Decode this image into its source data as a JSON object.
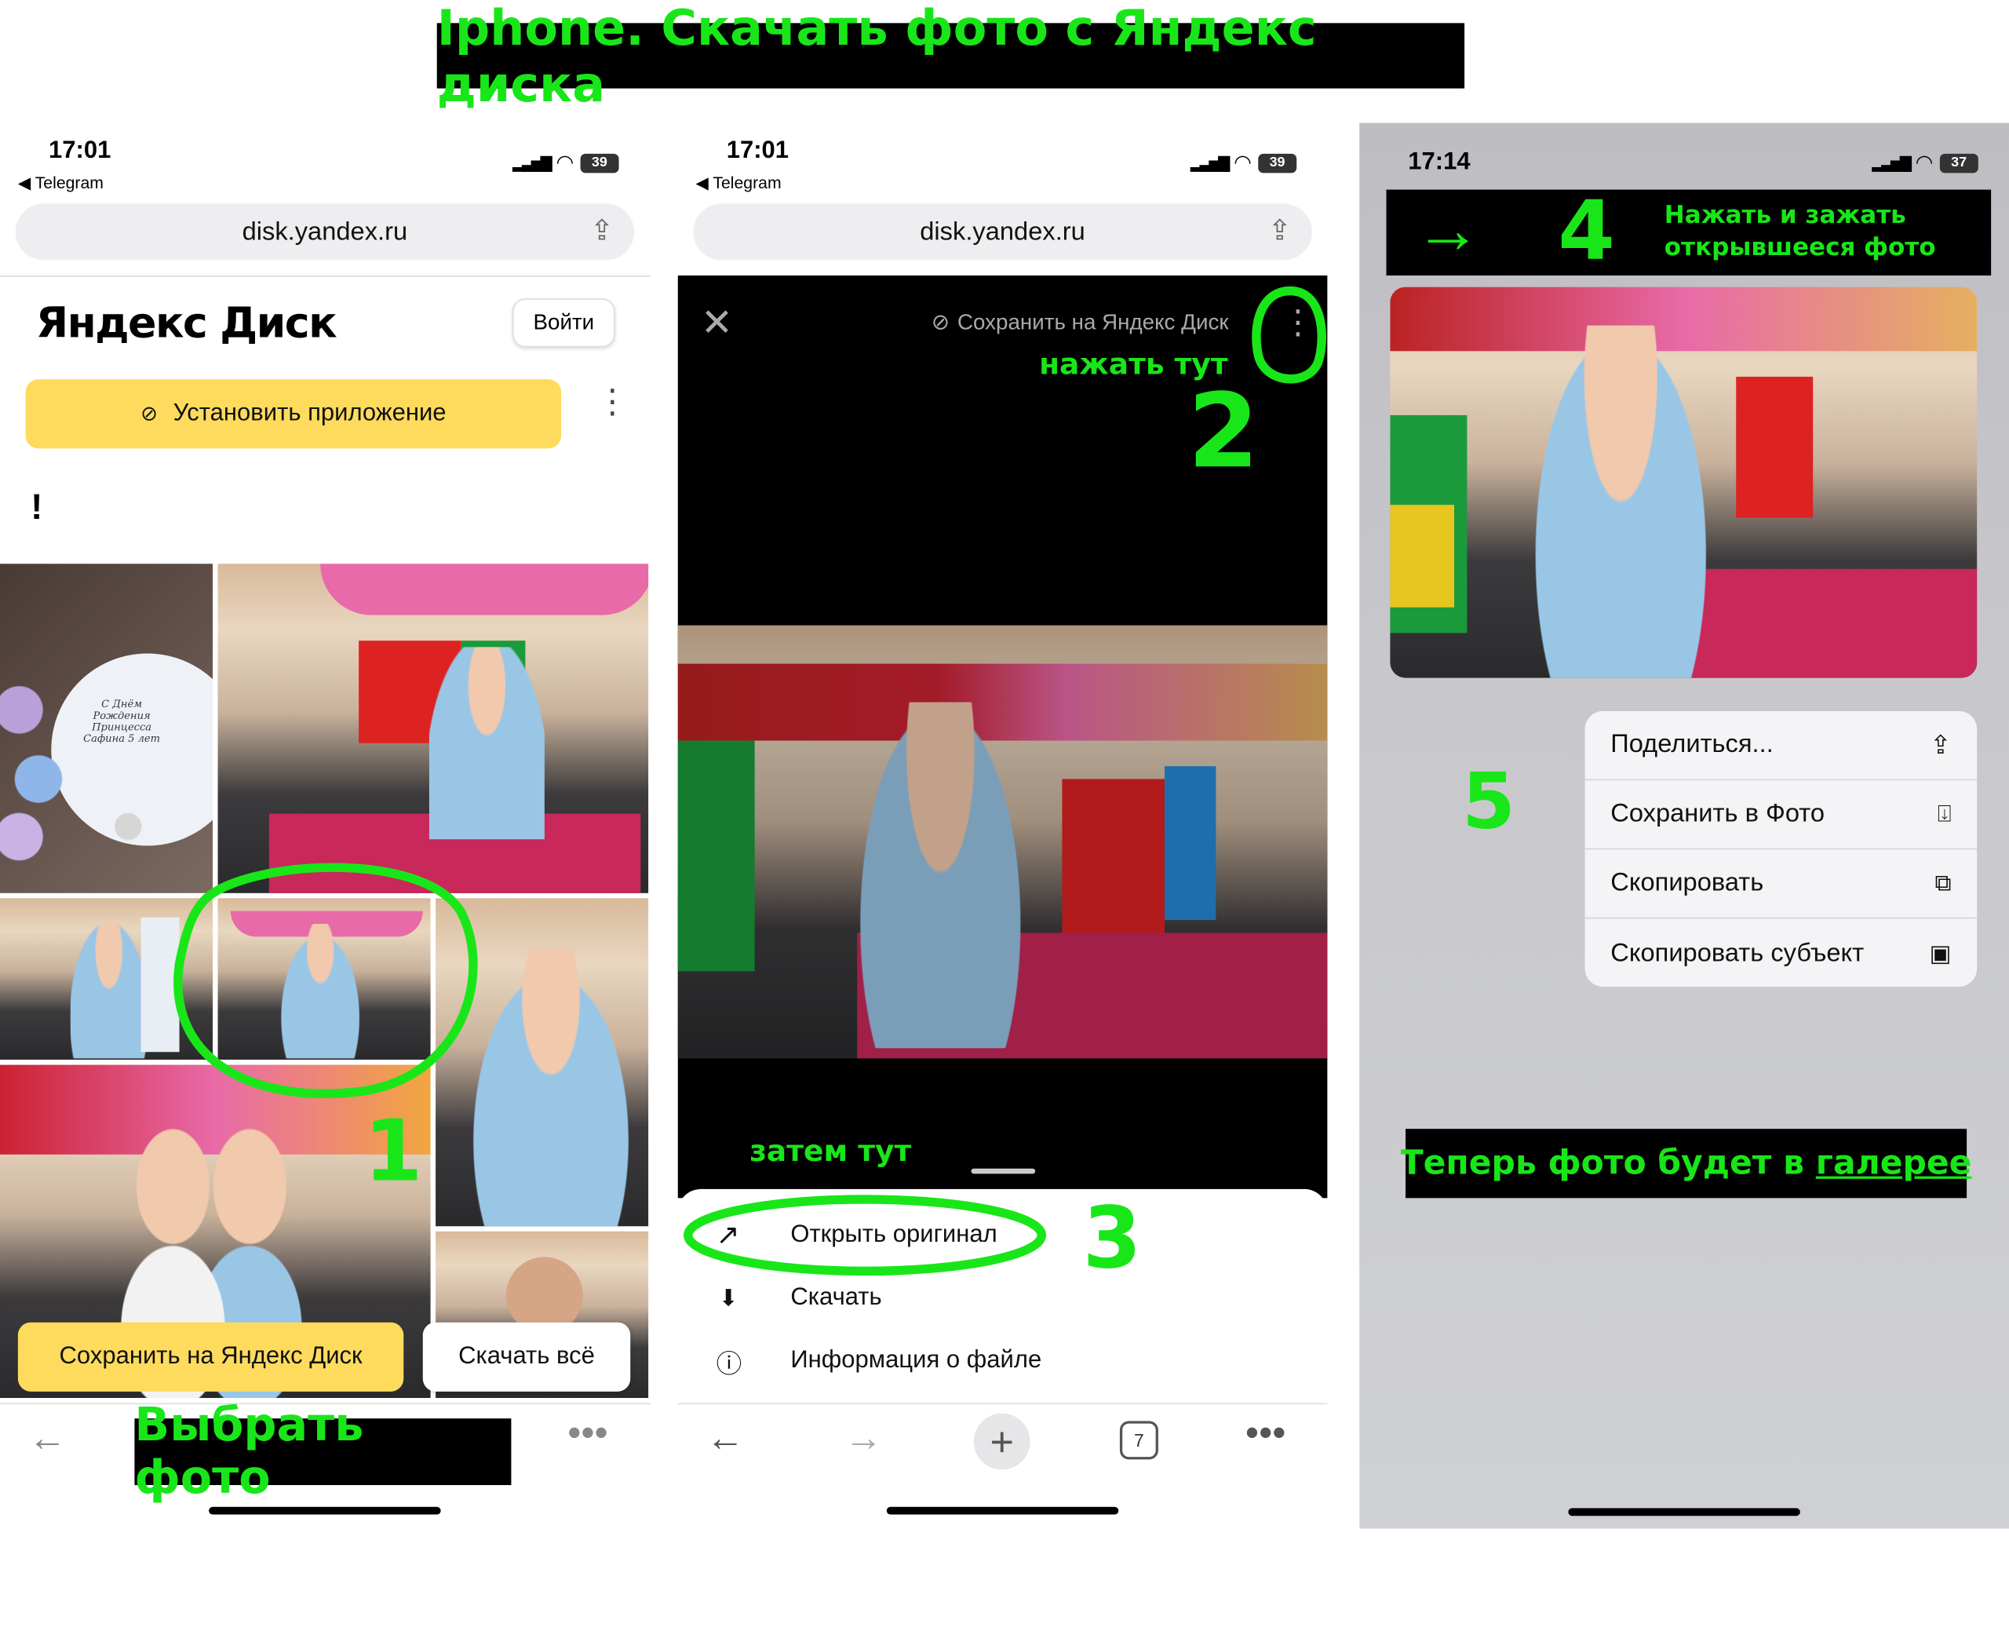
{
  "title": "Iphone. Скачать фото с Яндекс диска",
  "panel1": {
    "time": "17:01",
    "back_app": "◀ Telegram",
    "battery": "39",
    "url": "disk.yandex.ru",
    "logo": "Яндекс Диск",
    "login": "Войти",
    "install_app": "Установить приложение",
    "excl": "!",
    "card_text": "С Днём Рождения Принцесса Сафина 5 лет",
    "save_btn": "Сохранить на Яндекс Диск",
    "download_all": "Скачать всё",
    "annotation_step": "1",
    "caption": "Выбрать фото"
  },
  "panel2": {
    "time": "17:01",
    "back_app": "◀ Telegram",
    "battery": "39",
    "url": "disk.yandex.ru",
    "save_link": "Сохранить на Яндекс Диск",
    "hint_here": "нажать тут",
    "step2": "2",
    "hint_then": "затем тут",
    "open_original": "Открыть оригинал",
    "download": "Скачать",
    "file_info": "Информация о файле",
    "step3": "3",
    "tabs_count": "7"
  },
  "panel3": {
    "time": "17:14",
    "battery": "37",
    "step4": "4",
    "hint_press": "Нажать и зажать открывшееся фото",
    "step5": "5",
    "menu": [
      "Поделиться...",
      "Сохранить в Фото",
      "Скопировать",
      "Скопировать субъект"
    ],
    "result_prefix": "Теперь фото будет в ",
    "result_link": "галерее"
  }
}
